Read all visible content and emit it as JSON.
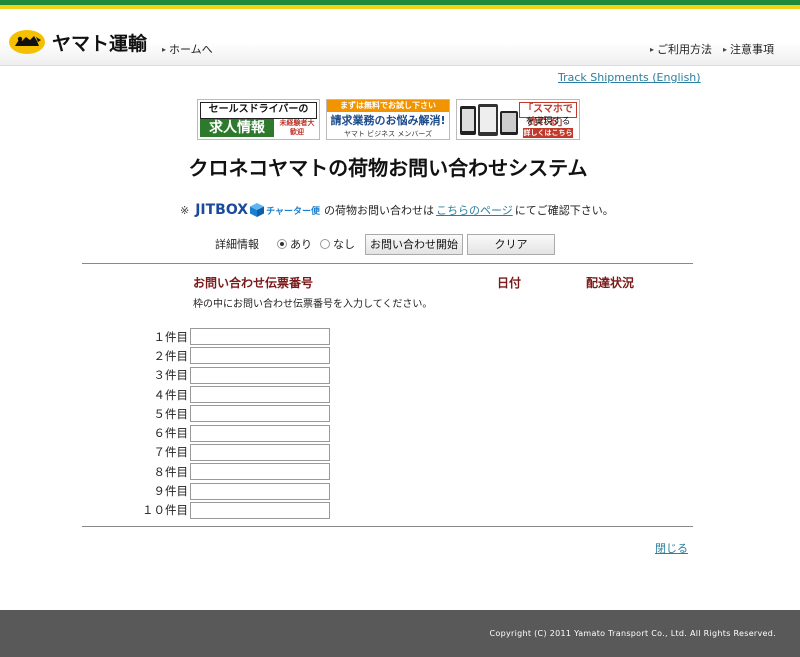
{
  "header": {
    "logo_text": "ヤマト運輸",
    "home_link": "ホームへ",
    "usage_link": "ご利用方法",
    "notes_link": "注意事項"
  },
  "track_link": "Track Shipments (English)",
  "banners": {
    "recruit": {
      "top": "セールスドライバーの",
      "main": "求人情報",
      "side": "未経験者大歓迎"
    },
    "business": {
      "top": "まずは無料でお試し下さい",
      "main": "請求業務のお悩み解消!",
      "bottom": "ヤマト ビジネス メンバーズ"
    },
    "smartphone": {
      "main": "「スマホで売れる」",
      "sub": "を実現する",
      "cta": "詳しくはこちら"
    }
  },
  "page_title": "クロネコヤマトの荷物お問い合わせシステム",
  "jitbox": {
    "mark": "※",
    "logo": "JITBOX",
    "charter": "チャーター便",
    "text_before": "の荷物お問い合わせは",
    "link": "こちらのページ",
    "text_after": "にてご確認下さい。"
  },
  "detail": {
    "label": "詳細情報",
    "option_yes": "あり",
    "option_no": "なし",
    "selected": "あり",
    "submit_button": "お問い合わせ開始",
    "clear_button": "クリア"
  },
  "columns": {
    "number": "お問い合わせ伝票番号",
    "date": "日付",
    "status": "配達状況"
  },
  "instruction": "枠の中にお問い合わせ伝票番号を入力してください。",
  "rows": [
    {
      "label": "１件目",
      "value": ""
    },
    {
      "label": "２件目",
      "value": ""
    },
    {
      "label": "３件目",
      "value": ""
    },
    {
      "label": "４件目",
      "value": ""
    },
    {
      "label": "５件目",
      "value": ""
    },
    {
      "label": "６件目",
      "value": ""
    },
    {
      "label": "７件目",
      "value": ""
    },
    {
      "label": "８件目",
      "value": ""
    },
    {
      "label": "９件目",
      "value": ""
    },
    {
      "label": "１０件目",
      "value": ""
    }
  ],
  "close_link": "閉じる",
  "footer": {
    "copyright": "Copyright (C) 2011 Yamato Transport Co., Ltd. All Rights Reserved."
  },
  "colors": {
    "brand_green": "#1f8a3a",
    "brand_yellow": "#f5d21a",
    "heading_red": "#7a1a1a",
    "link_blue": "#2a7fa0",
    "footer_gray": "#595959"
  }
}
